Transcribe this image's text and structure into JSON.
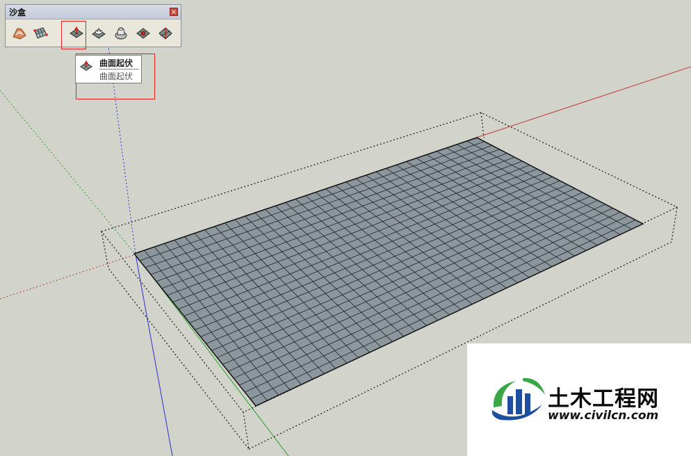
{
  "toolbar": {
    "title": "沙盒",
    "close_glyph": "×",
    "tools": [
      {
        "icon": "contour-sandbox-icon"
      },
      {
        "icon": "grid-sandbox-icon"
      },
      {
        "icon": "smoove-icon",
        "active": true
      },
      {
        "icon": "stamp-icon"
      },
      {
        "icon": "drape-icon"
      },
      {
        "icon": "add-detail-icon"
      },
      {
        "icon": "flip-edge-icon"
      }
    ]
  },
  "tooltip": {
    "title": "曲面起伏",
    "description": "曲面起伏"
  },
  "watermark": {
    "name_cn": "土木工程网",
    "url": "www.civilcn.com"
  },
  "colors": {
    "background": "#d2d4cc",
    "surface": "#8b969d",
    "grid_line": "#1f2326",
    "highlight": "#e02020",
    "axis_red": "#c23a3a",
    "axis_green": "#2aa12a",
    "axis_blue": "#2b2bd6",
    "logo_blue": "#1d4f9e",
    "logo_green": "#3aa645"
  }
}
